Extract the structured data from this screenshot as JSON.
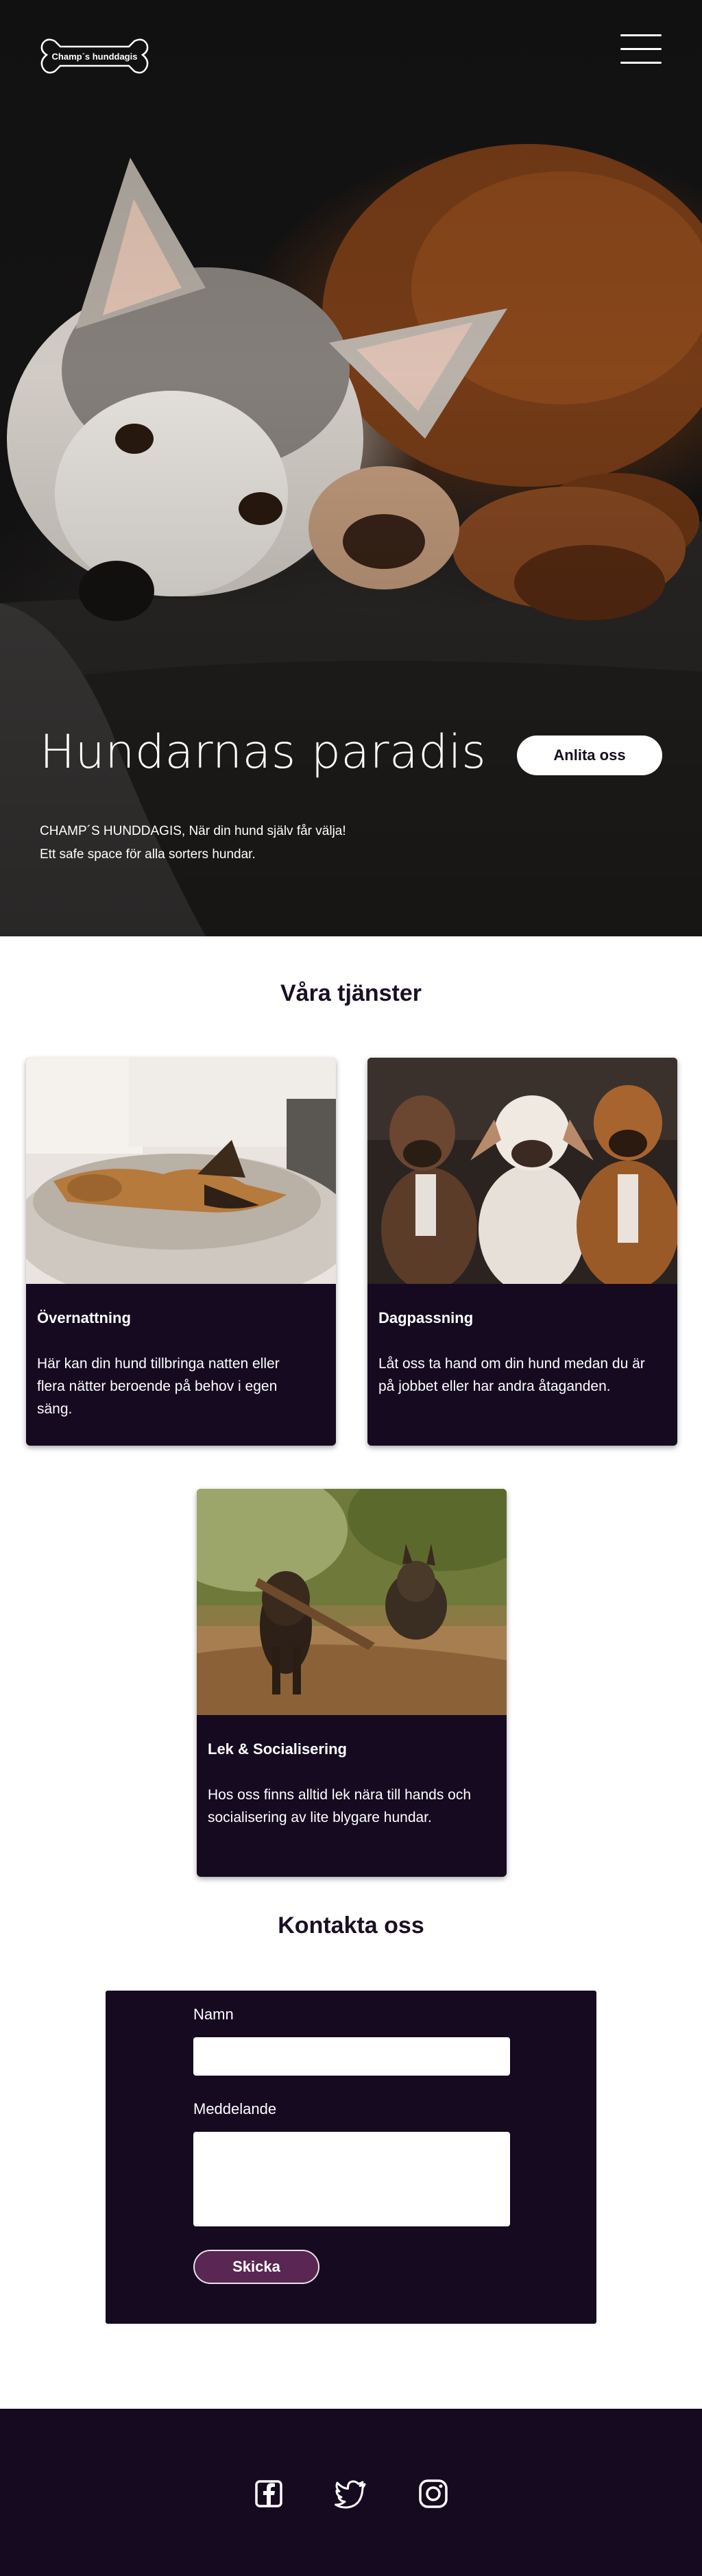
{
  "header": {
    "logo_text": "Champ´s hunddagis",
    "menu_icon": "hamburger-menu-icon"
  },
  "hero": {
    "title": "Hundarnas paradis",
    "cta_label": "Anlita oss",
    "line1": "CHAMP´S HUNDDAGIS, När din hund själv får välja!",
    "line2": "Ett safe space för alla sorters hundar."
  },
  "services": {
    "title": "Våra tjänster",
    "items": [
      {
        "title": "Övernattning",
        "text": "Här kan din hund tillbringa natten eller flera nätter beroende på behov i egen säng."
      },
      {
        "title": "Dagpassning",
        "text": "Låt oss ta hand om din hund medan du är på jobbet eller har andra åtaganden."
      },
      {
        "title": "Lek & Socialisering",
        "text": "Hos oss finns alltid lek nära till hands och socialisering av lite blygare hundar."
      }
    ]
  },
  "contact": {
    "title": "Kontakta oss",
    "name_label": "Namn",
    "name_value": "",
    "message_label": "Meddelande",
    "message_value": "",
    "submit_label": "Skicka"
  },
  "footer": {
    "social_icons": [
      "facebook-icon",
      "twitter-icon",
      "instagram-icon"
    ]
  },
  "colors": {
    "dark_purple": "#150a20",
    "button_purple": "#5a2653",
    "white": "#ffffff"
  }
}
